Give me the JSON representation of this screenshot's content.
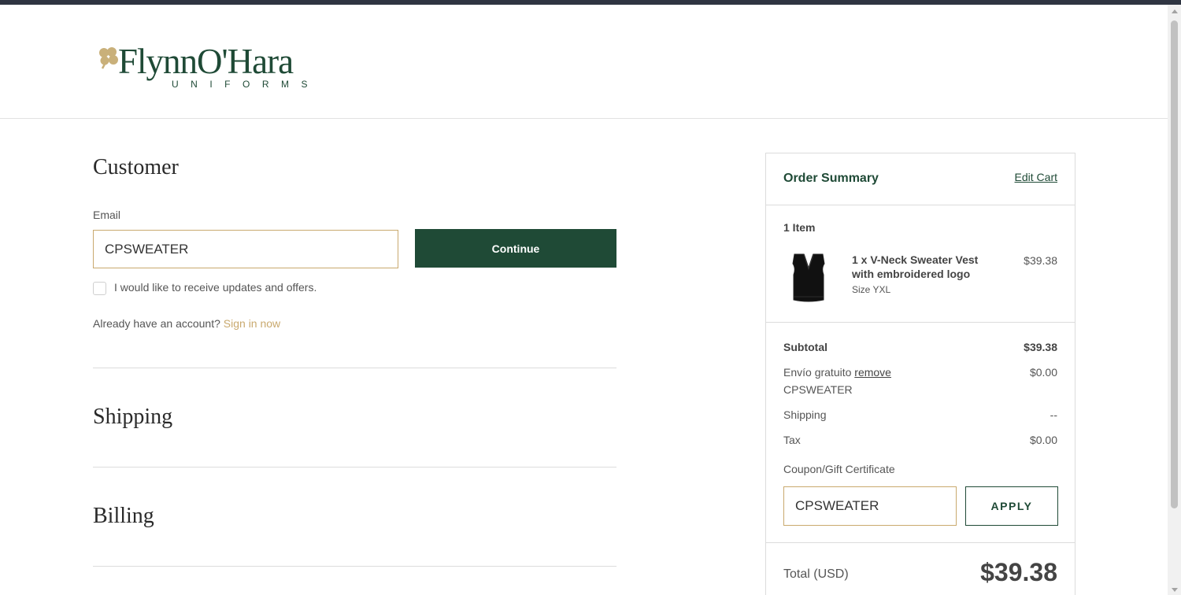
{
  "brand": {
    "name": "FlynnO'Hara",
    "subtitle": "UNIFORMS"
  },
  "customer": {
    "title": "Customer",
    "email_label": "Email",
    "email_value": "CPSWEATER",
    "continue_label": "Continue",
    "updates_label": "I would like to receive updates and offers.",
    "updates_checked": false,
    "account_prompt": "Already have an account?",
    "signin_label": "Sign in now"
  },
  "shipping": {
    "title": "Shipping"
  },
  "billing": {
    "title": "Billing"
  },
  "summary": {
    "title": "Order Summary",
    "edit_cart_label": "Edit Cart",
    "items_count": "1 Item",
    "item": {
      "name": "1 x V-Neck Sweater Vest with embroidered logo",
      "size": "Size YXL",
      "price": "$39.38"
    },
    "subtotal_label": "Subtotal",
    "subtotal_value": "$39.38",
    "discount_label": "Envío gratuito",
    "discount_remove_label": "remove",
    "discount_code": "CPSWEATER",
    "discount_value": "$0.00",
    "shipping_label": "Shipping",
    "shipping_value": "--",
    "tax_label": "Tax",
    "tax_value": "$0.00",
    "coupon_label": "Coupon/Gift Certificate",
    "coupon_value": "CPSWEATER",
    "apply_label": "APPLY",
    "total_label": "Total (USD)",
    "total_value": "$39.38"
  },
  "colors": {
    "brand_green": "#1f4a36",
    "gold_accent": "#c9a96e",
    "top_bar": "#2f3542"
  },
  "icons": {
    "logo_mark": "shamrock-icon",
    "product_image": "sweater-vest-image"
  }
}
